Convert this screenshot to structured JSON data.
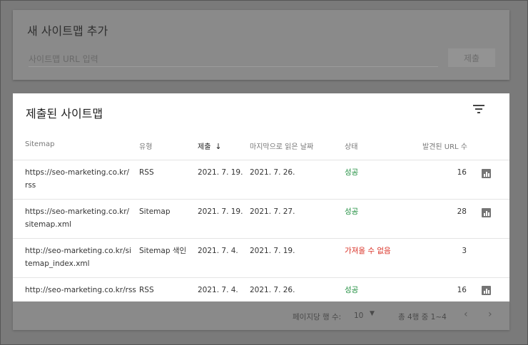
{
  "add_sitemap": {
    "title": "새 사이트맵 추가",
    "input_placeholder": "사이트맵 URL 입력",
    "submit_label": "제출"
  },
  "submitted": {
    "title": "제출된 사이트맵",
    "columns": {
      "sitemap": "Sitemap",
      "type": "유형",
      "submitted": "제출",
      "last_read": "마지막으로 읽은 날짜",
      "status": "상태",
      "urls_found": "발견된 URL 수"
    },
    "rows": [
      {
        "url": "https://seo-marketing.co.kr/rss",
        "type": "RSS",
        "submitted": "2021. 7. 19.",
        "last_read": "2021. 7. 26.",
        "status": "성공",
        "status_kind": "ok",
        "urls": "16",
        "has_chart": true
      },
      {
        "url": "https://seo-marketing.co.kr/sitemap.xml",
        "type": "Sitemap",
        "submitted": "2021. 7. 19.",
        "last_read": "2021. 7. 27.",
        "status": "성공",
        "status_kind": "ok",
        "urls": "28",
        "has_chart": true
      },
      {
        "url": "http://seo-marketing.co.kr/sitemap_index.xml",
        "type": "Sitemap 색인",
        "submitted": "2021. 7. 4.",
        "last_read": "2021. 7. 19.",
        "status": "가져올 수 없음",
        "status_kind": "fail",
        "urls": "3",
        "has_chart": false
      },
      {
        "url": "http://seo-marketing.co.kr/rss",
        "type": "RSS",
        "submitted": "2021. 7. 4.",
        "last_read": "2021. 7. 26.",
        "status": "성공",
        "status_kind": "ok",
        "urls": "16",
        "has_chart": true
      }
    ]
  },
  "pagination": {
    "rows_per_page_label": "페이지당 행 수:",
    "rows_per_page_value": "10",
    "range_label": "총 4행 중 1~4"
  },
  "icons": {
    "filter": "filter-icon",
    "sort": "arrow-down-icon",
    "chart": "bar-chart-icon",
    "dropdown": "caret-down-icon",
    "prev": "chevron-left-icon",
    "next": "chevron-right-icon"
  },
  "colors": {
    "success": "#1e8e3e",
    "error": "#d93025"
  }
}
